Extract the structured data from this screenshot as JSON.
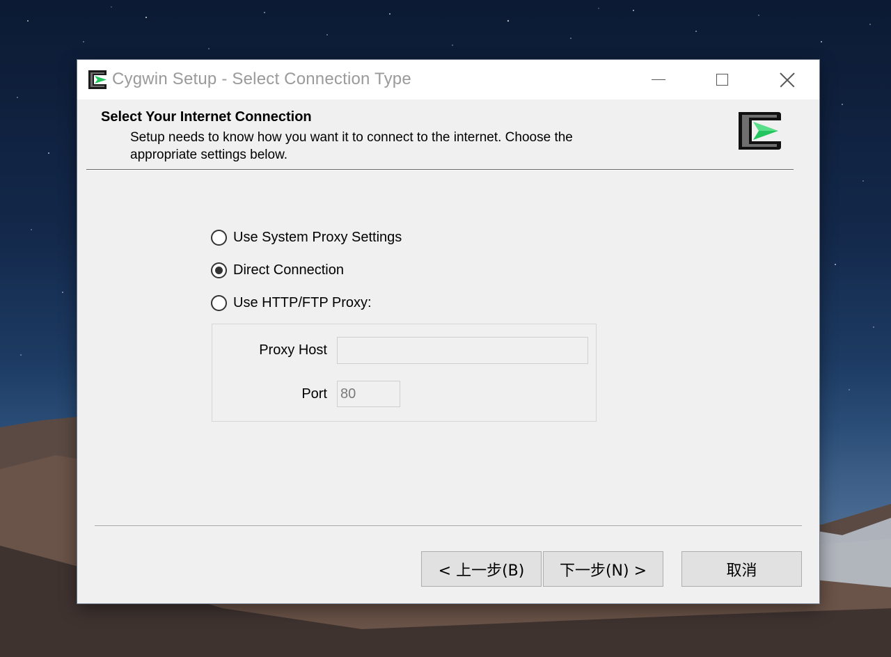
{
  "window": {
    "title": "Cygwin Setup - Select Connection Type",
    "controls": {
      "minimize": "minimize-icon",
      "maximize": "maximize-icon",
      "close": "close-icon"
    }
  },
  "header": {
    "title": "Select Your Internet Connection",
    "description": "Setup needs to know how you want it to connect to the internet.  Choose the appropriate settings below.",
    "logo": "cygwin-logo-icon"
  },
  "connection": {
    "options": [
      {
        "label": "Use System Proxy Settings",
        "checked": false
      },
      {
        "label": "Direct Connection",
        "checked": true
      },
      {
        "label": "Use HTTP/FTP Proxy:",
        "checked": false
      }
    ],
    "proxy_host_label": "Proxy Host",
    "proxy_host_value": "",
    "port_label": "Port",
    "port_value": "80"
  },
  "buttons": {
    "back": "< 上一步(B)",
    "next": "下一步(N) >",
    "cancel": "取消"
  },
  "colors": {
    "window_bg": "#f0f0f0",
    "titlebar_bg": "#ffffff",
    "button_bg": "#e1e1e1",
    "logo_green": "#22c55e"
  }
}
